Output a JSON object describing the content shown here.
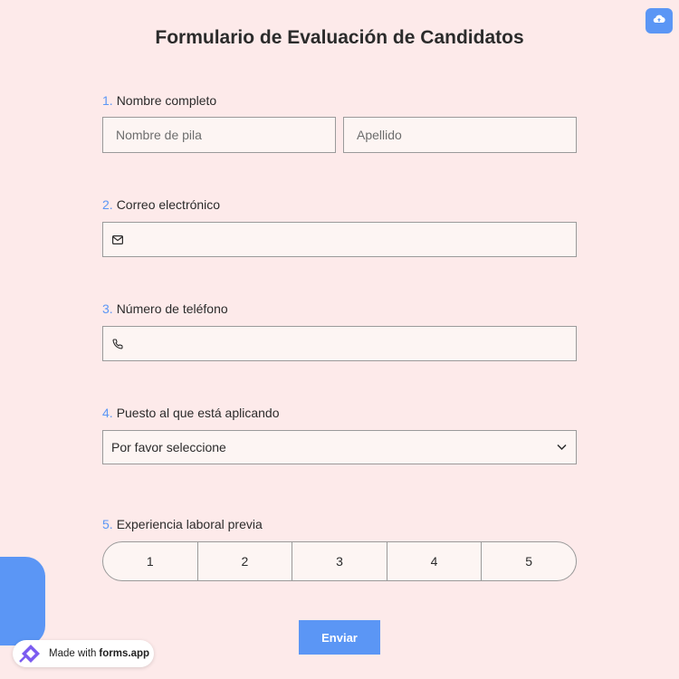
{
  "form": {
    "title": "Formulario de Evaluación de Candidatos",
    "q1": {
      "num": "1.",
      "label": "Nombre completo",
      "first_placeholder": "Nombre de pila",
      "last_placeholder": "Apellido"
    },
    "q2": {
      "num": "2.",
      "label": "Correo electrónico",
      "icon": "envelope-icon"
    },
    "q3": {
      "num": "3.",
      "label": "Número de teléfono",
      "icon": "phone-icon"
    },
    "q4": {
      "num": "4.",
      "label": "Puesto al que está aplicando",
      "selected": "Por favor seleccione",
      "icon": "chevron-down-icon"
    },
    "q5": {
      "num": "5.",
      "label": "Experiencia laboral previa",
      "options": [
        "1",
        "2",
        "3",
        "4",
        "5"
      ]
    },
    "submit_label": "Enviar"
  },
  "toolbar": {
    "upload_icon": "cloud-upload-icon"
  },
  "badge": {
    "prefix": "Made with",
    "brand": "forms.app"
  },
  "colors": {
    "background": "#fdeaea",
    "accent": "#5b96f5",
    "field_bg": "#fdf5f3",
    "border": "#9a9a9a"
  }
}
